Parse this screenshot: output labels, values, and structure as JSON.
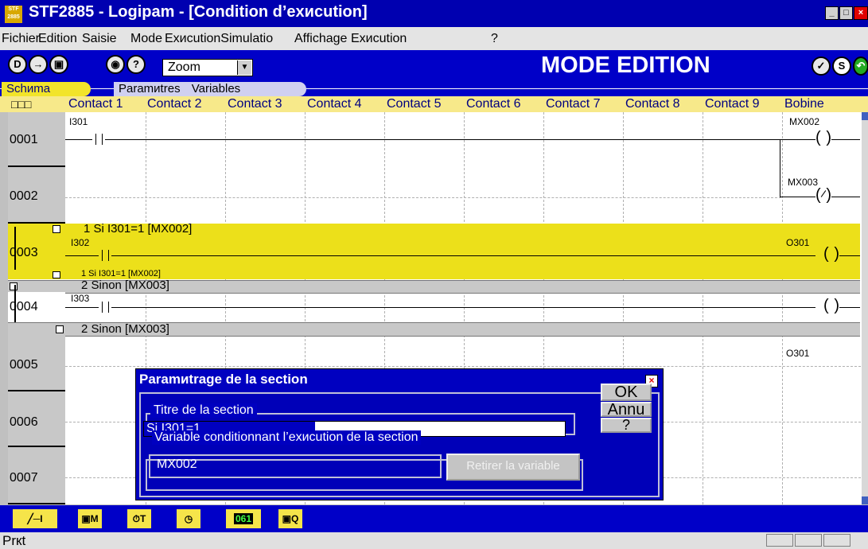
{
  "window": {
    "title": "STF2885 - Logipam  - [Condition d’exиcution]",
    "app_icon_text": "STF 2885"
  },
  "menu": [
    "Fichier",
    "Edition",
    "Saisie",
    "Mode",
    "ExиcutionSimulatio",
    "Affichage",
    "Exиcution",
    "?"
  ],
  "toolbar": {
    "zoom_value": "Zoom",
    "mode_label": "MODE EDITION",
    "icons": [
      "new-icon",
      "open-icon",
      "save-icon",
      "eye-icon",
      "help-icon"
    ],
    "right_icons": [
      "edit-mode-icon",
      "s-icon",
      "run-icon"
    ]
  },
  "tabs": [
    "Schиma",
    "Paramиtres",
    "Variables"
  ],
  "grid": {
    "corner_label": "□□□",
    "columns": [
      "Contact 1",
      "Contact 2",
      "Contact 3",
      "Contact 4",
      "Contact 5",
      "Contact 6",
      "Contact 7",
      "Contact 8",
      "Contact 9",
      "Bobine"
    ],
    "rows": [
      {
        "num": "0001",
        "contact_label": "I301",
        "coil_label": "MX002"
      },
      {
        "num": "0002",
        "contact_label": "",
        "coil_label": "MX003"
      },
      {
        "num": "0003",
        "contact_label": "I302",
        "coil_label": "O301"
      },
      {
        "num": "0004",
        "contact_label": "I303",
        "coil_label": ""
      },
      {
        "num": "0005",
        "contact_label": "",
        "coil_label": "O301"
      },
      {
        "num": "0006",
        "contact_label": "",
        "coil_label": ""
      },
      {
        "num": "0007",
        "contact_label": "",
        "coil_label": ""
      }
    ],
    "section1_start": "1 Si I301=1 [MX002]",
    "section1_end": "1 Si I301=1 [MX002]",
    "section2_start": "2 Sinon [MX003]",
    "section2_end": "2 Sinon [MX003]"
  },
  "dialog": {
    "title": "Paramиtrage de la section",
    "title_label": "Titre de la section",
    "title_value": "Si I301=1",
    "variable_label": "Variable conditionnant l’exиcution de la section",
    "variable_value": "MX002",
    "remove_button": "Retirer la variable",
    "ok_button": "OK",
    "cancel_button": "Annu",
    "help_button": "?"
  },
  "bottom_toolbar": {
    "icons": [
      "contact-input-icon",
      "memory-bit-icon",
      "timer-icon",
      "clock-icon",
      "counter-icon",
      "output-q-icon"
    ],
    "counter_text": "061"
  },
  "status": {
    "text": "Prкt"
  }
}
